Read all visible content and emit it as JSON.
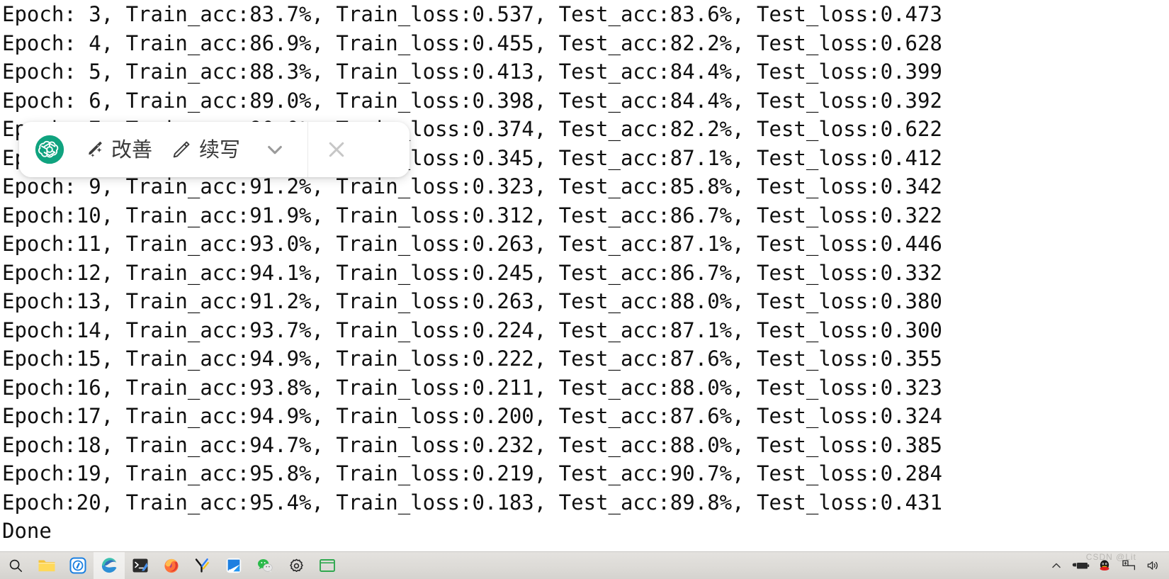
{
  "console": {
    "lines": [
      "Epoch: 3, Train_acc:83.7%, Train_loss:0.537, Test_acc:83.6%, Test_loss:0.473",
      "Epoch: 4, Train_acc:86.9%, Train_loss:0.455, Test_acc:82.2%, Test_loss:0.628",
      "Epoch: 5, Train_acc:88.3%, Train_loss:0.413, Test_acc:84.4%, Test_loss:0.399",
      "Epoch: 6, Train_acc:89.0%, Train_loss:0.398, Test_acc:84.4%, Test_loss:0.392",
      "Epoch: 7, Train_acc:90.0%, Train_loss:0.374, Test_acc:82.2%, Test_loss:0.622",
      "Epoch: 8, Train_acc:90.5%, Train_loss:0.345, Test_acc:87.1%, Test_loss:0.412",
      "Epoch: 9, Train_acc:91.2%, Train_loss:0.323, Test_acc:85.8%, Test_loss:0.342",
      "Epoch:10, Train_acc:91.9%, Train_loss:0.312, Test_acc:86.7%, Test_loss:0.322",
      "Epoch:11, Train_acc:93.0%, Train_loss:0.263, Test_acc:87.1%, Test_loss:0.446",
      "Epoch:12, Train_acc:94.1%, Train_loss:0.245, Test_acc:86.7%, Test_loss:0.332",
      "Epoch:13, Train_acc:91.2%, Train_loss:0.263, Test_acc:88.0%, Test_loss:0.380",
      "Epoch:14, Train_acc:93.7%, Train_loss:0.224, Test_acc:87.1%, Test_loss:0.300",
      "Epoch:15, Train_acc:94.9%, Train_loss:0.222, Test_acc:87.6%, Test_loss:0.355",
      "Epoch:16, Train_acc:93.8%, Train_loss:0.211, Test_acc:88.0%, Test_loss:0.323",
      "Epoch:17, Train_acc:94.9%, Train_loss:0.200, Test_acc:87.6%, Test_loss:0.324",
      "Epoch:18, Train_acc:94.7%, Train_loss:0.232, Test_acc:88.0%, Test_loss:0.385",
      "Epoch:19, Train_acc:95.8%, Train_loss:0.219, Test_acc:90.7%, Test_loss:0.284",
      "Epoch:20, Train_acc:95.4%, Train_loss:0.183, Test_acc:89.8%, Test_loss:0.431",
      "Done"
    ],
    "text_color": "#101010",
    "background": "#ffffff"
  },
  "assist_toolbar": {
    "brand_icon": "chatgpt-logo-icon",
    "brand_color": "#10A37F",
    "actions": [
      {
        "icon": "magic-wand-icon",
        "label": "改善"
      },
      {
        "icon": "pencil-icon",
        "label": "续写"
      }
    ],
    "expand_icon": "chevron-down-icon",
    "close_icon": "close-icon",
    "background": "#ffffff"
  },
  "taskbar": {
    "background": "#dddbd7",
    "items": [
      {
        "icon": "search-icon",
        "name": "taskbar-search"
      },
      {
        "icon": "folder-icon",
        "name": "taskbar-file-explorer"
      },
      {
        "icon": "kugou-icon",
        "name": "taskbar-kugou"
      },
      {
        "icon": "edge-icon",
        "name": "taskbar-edge",
        "active": true
      },
      {
        "icon": "terminal-icon",
        "name": "taskbar-terminal"
      },
      {
        "icon": "firefox-icon",
        "name": "taskbar-firefox"
      },
      {
        "icon": "xmind-icon",
        "name": "taskbar-xmind"
      },
      {
        "icon": "pycharm-icon",
        "name": "taskbar-pycharm"
      },
      {
        "icon": "wechat-icon",
        "name": "taskbar-wechat"
      },
      {
        "icon": "settings-icon",
        "name": "taskbar-settings"
      },
      {
        "icon": "window-icon",
        "name": "taskbar-window"
      }
    ],
    "tray": [
      {
        "icon": "show-hidden-icons-icon",
        "name": "tray-overflow"
      },
      {
        "icon": "battery-icon",
        "name": "tray-battery"
      },
      {
        "icon": "qq-icon",
        "name": "tray-qq"
      },
      {
        "icon": "ime-icon",
        "name": "tray-ime"
      },
      {
        "icon": "volume-icon",
        "name": "tray-volume"
      }
    ],
    "watermark": "CSDN @Lit"
  }
}
